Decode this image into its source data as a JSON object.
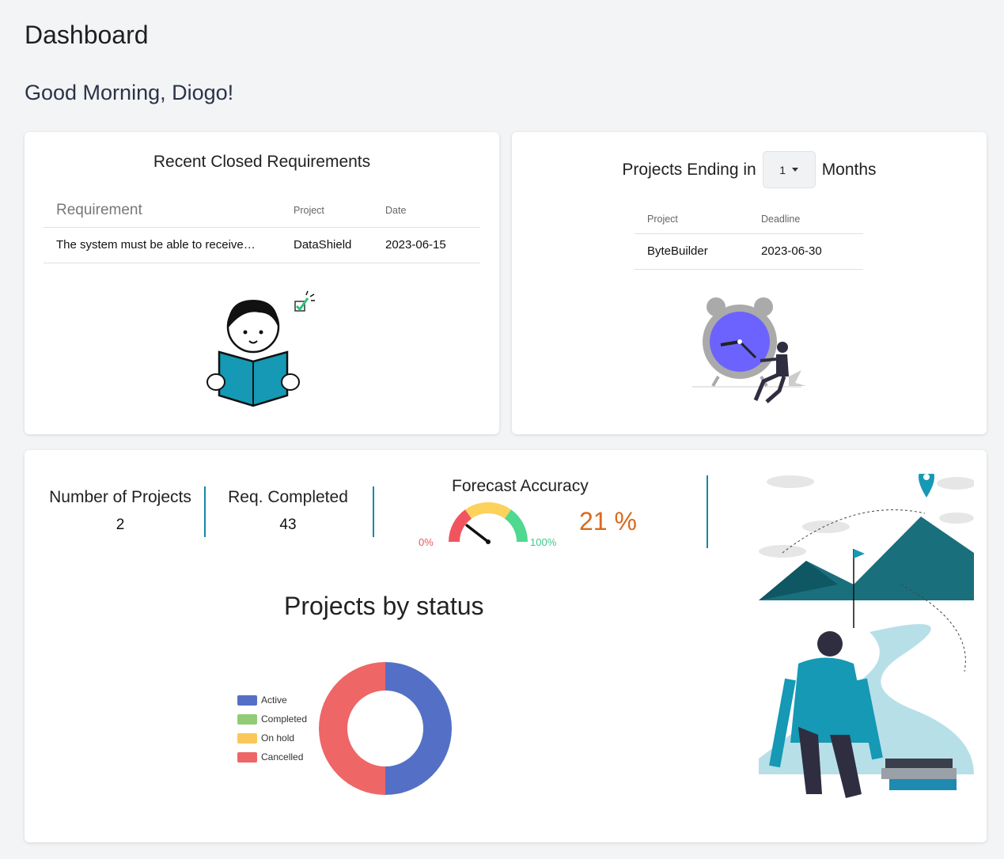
{
  "header": {
    "title": "Dashboard",
    "greeting": "Good Morning, Diogo!"
  },
  "closed_requirements": {
    "title": "Recent Closed Requirements",
    "columns": [
      "Requirement",
      "Project",
      "Date"
    ],
    "rows": [
      {
        "requirement": "The system must be able to receive…",
        "project": "DataShield",
        "date": "2023-06-15"
      }
    ]
  },
  "projects_ending": {
    "title_prefix": "Projects Ending in",
    "months_value": "1",
    "title_suffix": "Months",
    "columns": [
      "Project",
      "Deadline"
    ],
    "rows": [
      {
        "project": "ByteBuilder",
        "deadline": "2023-06-30"
      }
    ]
  },
  "stats": {
    "projects_label": "Number of Projects",
    "projects_value": "2",
    "req_label": "Req. Completed",
    "req_value": "43",
    "forecast_label": "Forecast Accuracy",
    "forecast_min": "0%",
    "forecast_max": "100%",
    "forecast_value": "21 %",
    "forecast_fraction": 0.21
  },
  "chart_data": {
    "type": "pie",
    "title": "Projects by status",
    "categories": [
      "Active",
      "Completed",
      "On hold",
      "Cancelled"
    ],
    "values": [
      1,
      0,
      0,
      1
    ],
    "colors": [
      "#5470c6",
      "#91cc75",
      "#fac858",
      "#ee6666"
    ],
    "legend_position": "left"
  }
}
